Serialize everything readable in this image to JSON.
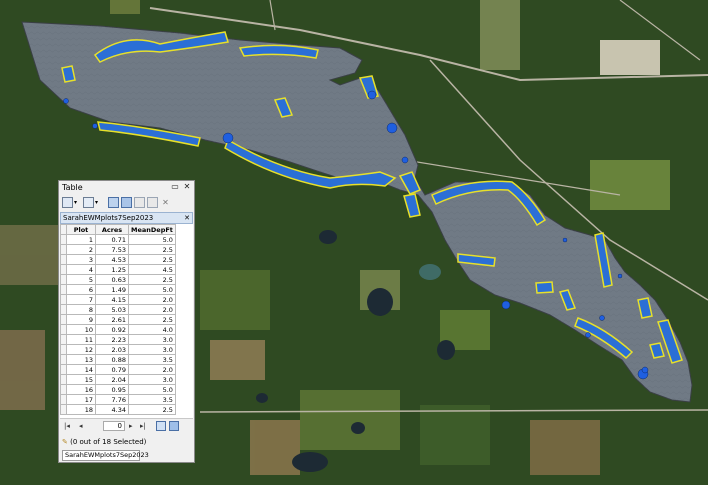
{
  "window": {
    "title": "Table",
    "pin_icon": "pin-icon",
    "close_icon": "close-icon"
  },
  "toolbar": {
    "icons": [
      "table-options-icon",
      "dropdown-icon",
      "related-tables-icon",
      "dropdown-icon",
      "select-by-attributes-icon",
      "switch-selection-icon",
      "clear-selection-icon",
      "zoom-to-selected-icon",
      "delete-selected-icon"
    ]
  },
  "layer_tab": {
    "name": "SarahEWMplots7Sep2023"
  },
  "table": {
    "columns": [
      "Plot",
      "Acres",
      "MeanDepFt"
    ],
    "rows": [
      [
        "1",
        "0.71",
        "5.0"
      ],
      [
        "2",
        "7.53",
        "2.5"
      ],
      [
        "3",
        "4.53",
        "2.5"
      ],
      [
        "4",
        "1.25",
        "4.5"
      ],
      [
        "5",
        "0.63",
        "2.5"
      ],
      [
        "6",
        "1.49",
        "5.0"
      ],
      [
        "7",
        "4.15",
        "2.0"
      ],
      [
        "8",
        "5.03",
        "2.0"
      ],
      [
        "9",
        "2.61",
        "2.5"
      ],
      [
        "10",
        "0.92",
        "4.0"
      ],
      [
        "11",
        "2.23",
        "3.0"
      ],
      [
        "12",
        "2.03",
        "3.0"
      ],
      [
        "13",
        "0.88",
        "3.5"
      ],
      [
        "14",
        "0.79",
        "2.0"
      ],
      [
        "15",
        "2.04",
        "3.0"
      ],
      [
        "16",
        "0.95",
        "5.0"
      ],
      [
        "17",
        "7.76",
        "3.5"
      ],
      [
        "18",
        "4.34",
        "2.5"
      ]
    ]
  },
  "navigation": {
    "current_record": "0"
  },
  "status": {
    "selection_text": "(0 out of 18 Selected)"
  },
  "colors": {
    "lake_fill": "#707a85",
    "plot_fill": "#2b6fd6",
    "plot_outline": "#e7e02a",
    "land": "#2f4a22"
  }
}
